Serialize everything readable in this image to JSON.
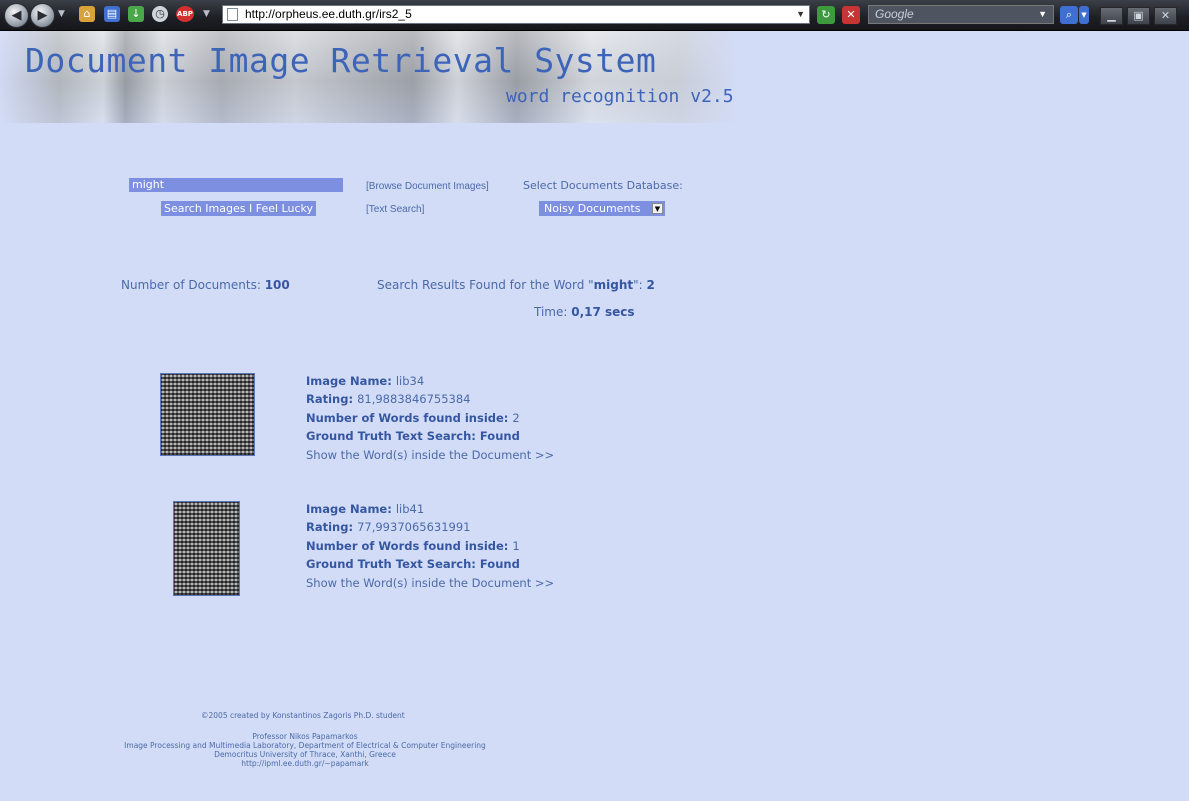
{
  "browser": {
    "url": "http://orpheus.ee.duth.gr/irs2_5",
    "search_placeholder": "Google",
    "colors": {
      "toolbar": "#1c1f24"
    }
  },
  "banner": {
    "title": "Document Image Retrieval System",
    "subtitle": "word recognition v2.5"
  },
  "search": {
    "query": "might",
    "search_button": "Search Images",
    "lucky_button": "I Feel Lucky",
    "browse_link": "[Browse Document Images]",
    "text_search_link": "[Text Search]",
    "db_label": "Select Documents Database:",
    "db_selected": "Noisy Documents"
  },
  "stats": {
    "docs_label": "Number of Documents: ",
    "docs_count": "100",
    "results_prefix": "Search Results Found for the Word \"",
    "results_word": "might",
    "results_middle": "\": ",
    "results_count": "2",
    "time_label": "Time: ",
    "time_value": "0,17 secs"
  },
  "labels": {
    "image_name": "Image Name: ",
    "rating": "Rating: ",
    "words_found": "Number of Words found inside: ",
    "ground_truth": "Ground Truth Text Search: ",
    "show_words": "Show the Word(s) inside the Document >>"
  },
  "results": [
    {
      "image_name": "lib34",
      "rating": "81,9883846755384",
      "words_found": "2",
      "ground_truth": "Found"
    },
    {
      "image_name": "lib41",
      "rating": "77,9937065631991",
      "words_found": "1",
      "ground_truth": "Found"
    }
  ],
  "footer": {
    "credit": "©2005 created by Konstantinos Zagoris Ph.D. student",
    "professor": "Professor Nikos Papamarkos",
    "lab": "Image Processing and Multimedia Laboratory, Department of Electrical & Computer Engineering",
    "university": "Democritus University of Thrace, Xanthi, Greece",
    "website": "http://ipml.ee.duth.gr/~papamark"
  },
  "colors": {
    "page_bg": "#d3dcf7",
    "accent": "#7c8fe0",
    "text": "#4a6aa8"
  },
  "icons": [
    "back-icon",
    "forward-icon",
    "home-icon",
    "bookmarks-icon",
    "download-icon",
    "history-icon",
    "adblock-icon",
    "reload-icon",
    "stop-icon",
    "search-engine-icon",
    "minimize-icon",
    "maximize-icon",
    "close-icon"
  ]
}
